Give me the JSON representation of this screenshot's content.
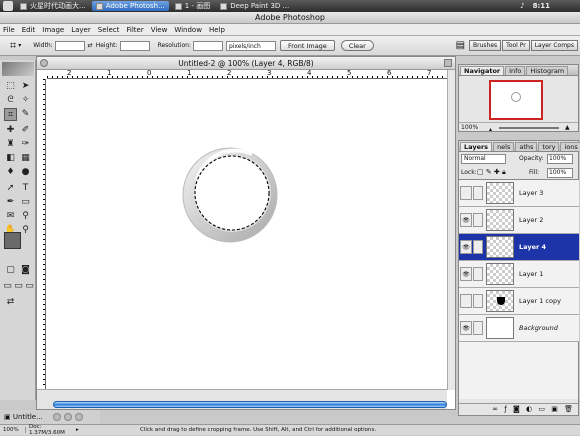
{
  "os_bar": {
    "tabs": [
      "火星时代动画大...",
      "Adobe Photosh...",
      "1 - 画图",
      "Deep Paint 3D ..."
    ],
    "active_tab": 1,
    "clock": "8:11"
  },
  "app": {
    "title": "Adobe Photoshop"
  },
  "menu": [
    "File",
    "Edit",
    "Image",
    "Layer",
    "Select",
    "Filter",
    "View",
    "Window",
    "Help"
  ],
  "options": {
    "width_label": "Width:",
    "height_label": "Height:",
    "resolution_label": "Resolution:",
    "units": "pixels/inch",
    "front_image": "Front Image",
    "clear": "Clear",
    "palette_tabs": [
      "Brushes",
      "Tool Pr",
      "Layer Comps"
    ]
  },
  "document": {
    "title": "Untitled-2 @ 100% (Layer 4, RGB/8)",
    "ruler_labels": [
      "2",
      "1",
      "0",
      "1",
      "2",
      "3",
      "4",
      "5",
      "6",
      "7"
    ]
  },
  "navigator": {
    "tabs": [
      "Navigator",
      "Info",
      "Histogram"
    ],
    "zoom": "100%"
  },
  "layers_panel": {
    "tabs": [
      "Layers",
      "nels",
      "aths",
      "tory",
      "ions"
    ],
    "blend_mode": "Normal",
    "opacity_label": "Opacity:",
    "opacity": "100%",
    "lock_label": "Lock:",
    "fill_label": "Fill:",
    "fill": "100%",
    "layers": [
      {
        "name": "Layer 3",
        "visible": false,
        "selected": false
      },
      {
        "name": "Layer 2",
        "visible": true,
        "selected": false
      },
      {
        "name": "Layer 4",
        "visible": true,
        "selected": true
      },
      {
        "name": "Layer 1",
        "visible": true,
        "selected": false
      },
      {
        "name": "Layer 1 copy",
        "visible": false,
        "selected": false
      },
      {
        "name": "Background",
        "visible": true,
        "selected": false
      }
    ]
  },
  "taskbar": {
    "minimized_doc": "Untitle..."
  },
  "status": {
    "zoom": "100%",
    "doc_size": "Doc: 1.37M/3.60M",
    "hint": "Click and drag to define cropping frame. Use Shift, Alt, and Ctrl for additional options."
  },
  "colors": {
    "selected_layer": "#1d34a8",
    "scroll_thumb": "#2d7bd8"
  }
}
